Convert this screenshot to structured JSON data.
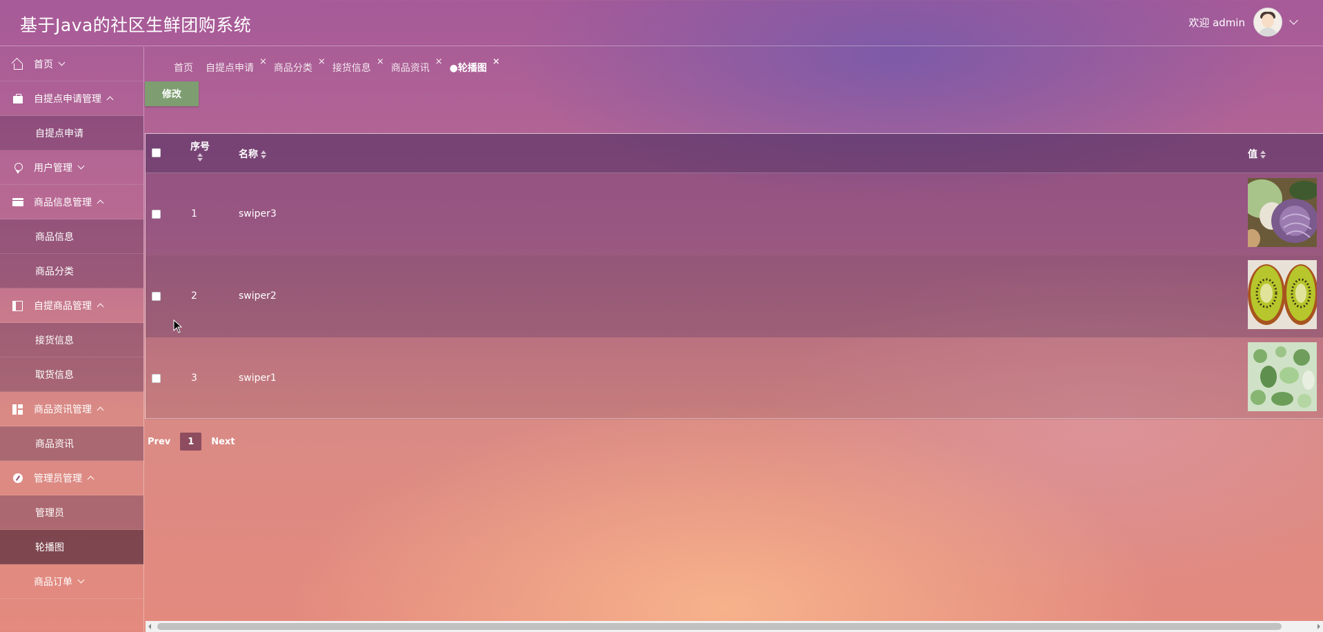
{
  "header": {
    "title": "基于Java的社区生鲜团购系统",
    "welcome": "欢迎 admin"
  },
  "sidebar": {
    "items": [
      {
        "label": "首页",
        "type": "top",
        "icon": "home-icon",
        "chevron": "down"
      },
      {
        "label": "自提点申请管理",
        "type": "top",
        "icon": "briefcase-icon",
        "chevron": "up"
      },
      {
        "label": "自提点申请",
        "type": "sub"
      },
      {
        "label": "用户管理",
        "type": "top",
        "icon": "badge-icon",
        "chevron": "down"
      },
      {
        "label": "商品信息管理",
        "type": "top",
        "icon": "card-icon",
        "chevron": "up"
      },
      {
        "label": "商品信息",
        "type": "sub"
      },
      {
        "label": "商品分类",
        "type": "sub"
      },
      {
        "label": "自提商品管理",
        "type": "top",
        "icon": "layout-icon",
        "chevron": "up"
      },
      {
        "label": "接货信息",
        "type": "sub"
      },
      {
        "label": "取货信息",
        "type": "sub"
      },
      {
        "label": "商品资讯管理",
        "type": "top",
        "icon": "dashboard-icon",
        "chevron": "up"
      },
      {
        "label": "商品资讯",
        "type": "sub"
      },
      {
        "label": "管理员管理",
        "type": "top",
        "icon": "compass-icon",
        "chevron": "up"
      },
      {
        "label": "管理员",
        "type": "sub"
      },
      {
        "label": "轮播图",
        "type": "sub",
        "active": true
      },
      {
        "label": "商品订单",
        "type": "top",
        "icon": "",
        "chevron": "down"
      }
    ]
  },
  "tabs": [
    {
      "label": "首页",
      "closable": false
    },
    {
      "label": "自提点申请",
      "closable": true
    },
    {
      "label": "商品分类",
      "closable": true
    },
    {
      "label": "接货信息",
      "closable": true
    },
    {
      "label": "商品资讯",
      "closable": true
    },
    {
      "label": "●轮播图",
      "closable": true,
      "active": true
    }
  ],
  "toolbar": {
    "edit_label": "修改"
  },
  "table": {
    "headers": {
      "seq": "序号",
      "name": "名称",
      "value": "值"
    },
    "rows": [
      {
        "idx": "1",
        "name": "swiper3",
        "image": "vegetables"
      },
      {
        "idx": "2",
        "name": "swiper2",
        "image": "kiwi"
      },
      {
        "idx": "3",
        "name": "swiper1",
        "image": "greens"
      }
    ]
  },
  "pagination": {
    "prev": "Prev",
    "page": "1",
    "next": "Next"
  },
  "close_glyph": "×"
}
